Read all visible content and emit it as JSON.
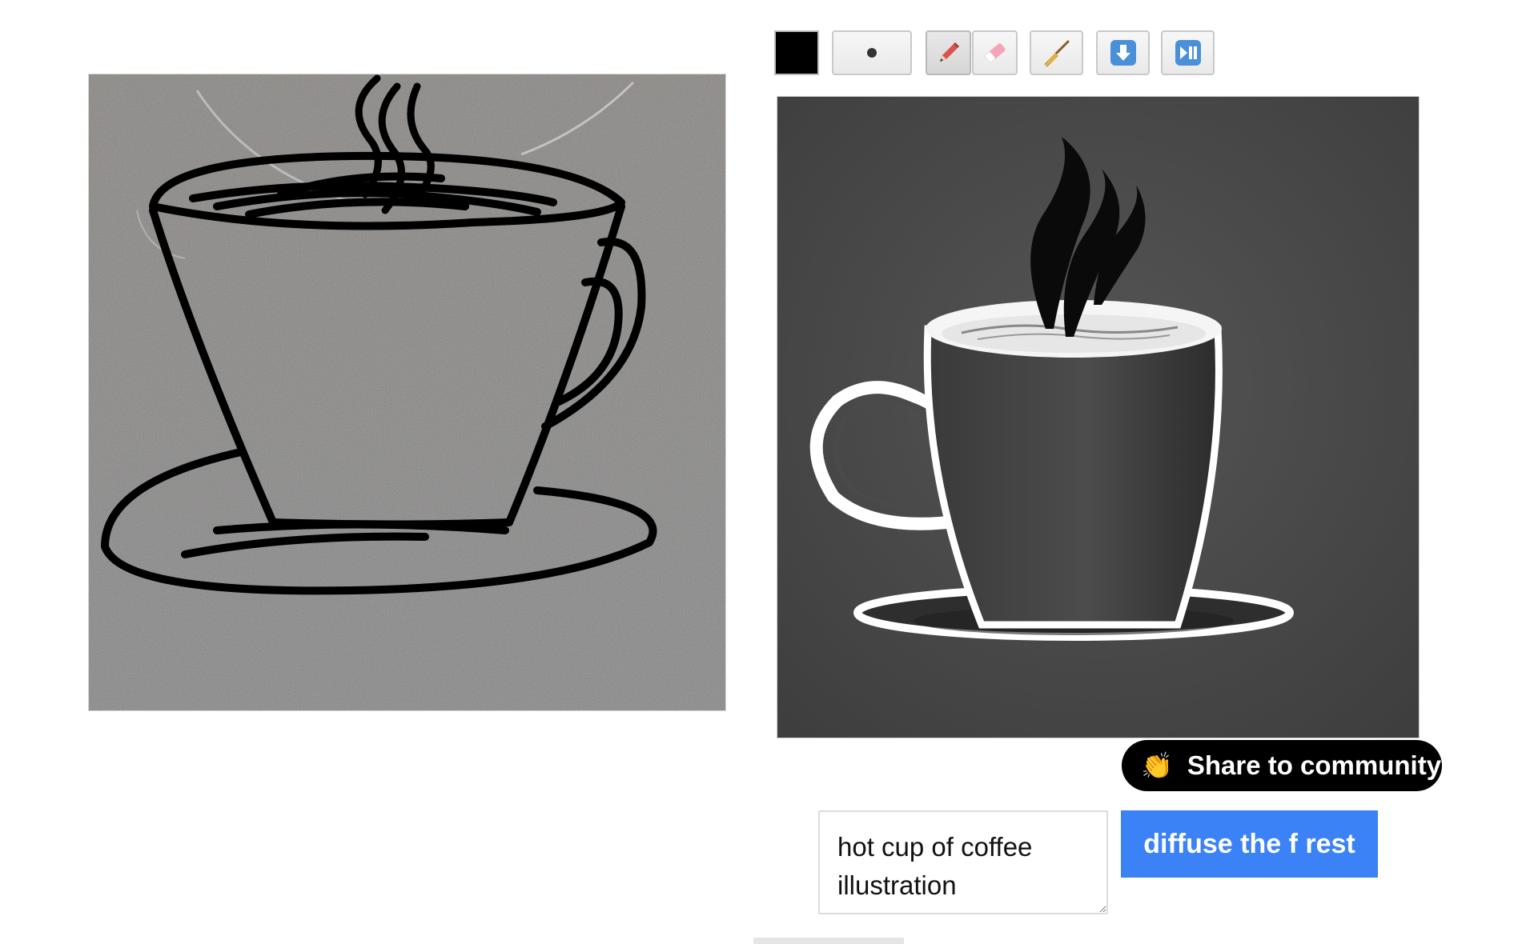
{
  "toolbar": {
    "color_value": "#000000",
    "brush_size_icon": "dot-icon",
    "tools": [
      "pencil-icon",
      "eraser-icon",
      "broom-icon",
      "download-icon",
      "play-pause-icon"
    ]
  },
  "share_button": {
    "label": "Share to community",
    "icon": "clapping-hands-icon"
  },
  "prompt": {
    "value": "hot cup of coffee illustration"
  },
  "diffuse_button": {
    "label": "diffuse the f rest"
  },
  "colors": {
    "accent": "#3b82f6",
    "share_bg": "#000000",
    "output_bg": "#4a4a4a"
  }
}
